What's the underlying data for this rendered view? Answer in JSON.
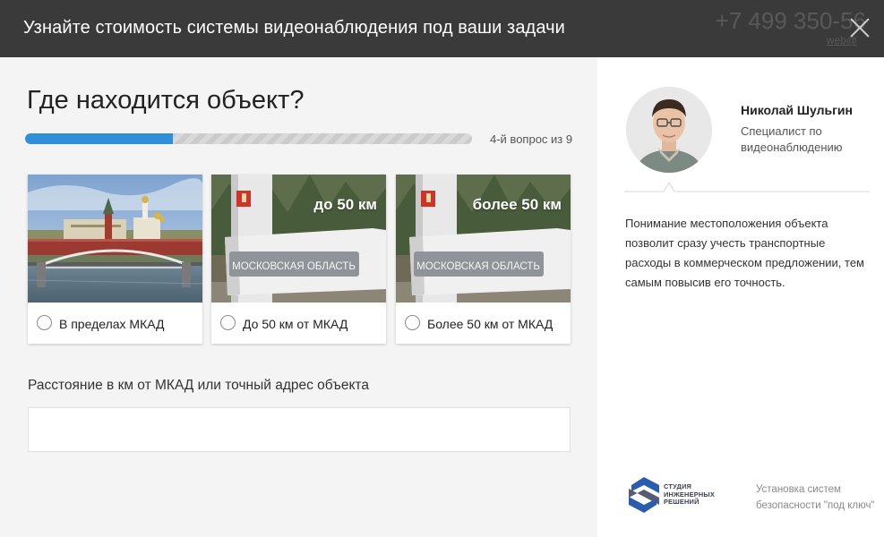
{
  "modal": {
    "title": "Узнайте стоимость системы видеонаблюдения под ваши задачи",
    "background_phone": "+7 499 350-56",
    "background_email": "web@"
  },
  "quiz": {
    "question": "Где находится объект?",
    "progress": {
      "current": 4,
      "total": 9,
      "label": "4-й вопрос из 9",
      "fill_fraction": 0.33
    },
    "options": [
      {
        "label": "В пределах МКАД",
        "photo_caption": ""
      },
      {
        "label": "До 50 км от МКАД",
        "photo_caption": "до 50 км"
      },
      {
        "label": "Более 50 км от МКАД",
        "photo_caption": "более 50 км"
      }
    ],
    "sign_text": "МОСКОВСКАЯ ОБЛАСТЬ",
    "address_label": "Расстояние в км от МКАД или точный адрес объекта",
    "address_value": "",
    "address_placeholder": ""
  },
  "consultant": {
    "name": "Николай Шульгин",
    "role": "Специалист по видеонаблюдению",
    "info": "Понимание местоположения объекта позволит сразу учесть транспортные расходы в коммерческом предложении, тем самым повысив его точность."
  },
  "footer": {
    "logo_line1": "СТУДИЯ",
    "logo_line2": "ИНЖЕНЕРНЫХ",
    "logo_line3": "РЕШЕНИЙ",
    "tagline": "Установка систем безопасности \"под ключ\""
  },
  "colors": {
    "accent": "#2f8fda",
    "topbar": "#3a3a3a",
    "logo_blue": "#2a5cb0",
    "logo_dark": "#3a3f55"
  }
}
